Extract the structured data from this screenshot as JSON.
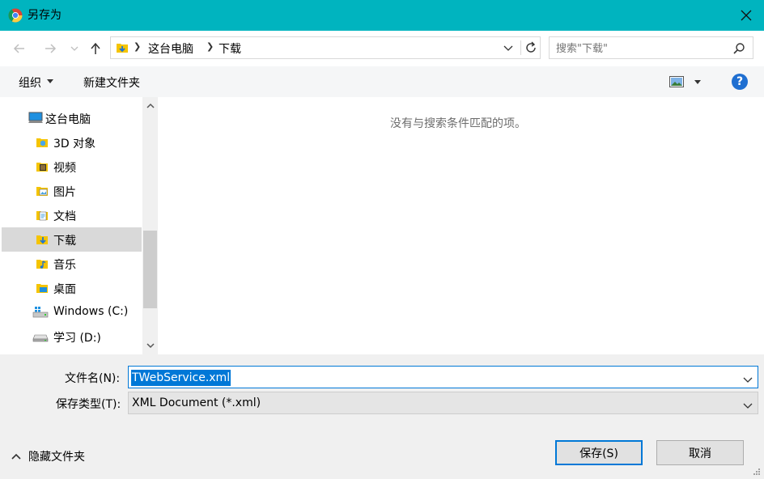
{
  "window": {
    "title": "另存为",
    "accent_color": "#00B4BF"
  },
  "nav": {
    "breadcrumb": [
      "这台电脑",
      "下载"
    ],
    "search_placeholder": "搜索\"下载\""
  },
  "toolbar": {
    "organize_label": "组织",
    "new_folder_label": "新建文件夹"
  },
  "sidebar": {
    "items": [
      {
        "label": "这台电脑",
        "icon": "computer-icon"
      },
      {
        "label": "3D 对象",
        "icon": "3d-objects-folder-icon"
      },
      {
        "label": "视频",
        "icon": "videos-folder-icon"
      },
      {
        "label": "图片",
        "icon": "pictures-folder-icon"
      },
      {
        "label": "文档",
        "icon": "documents-folder-icon"
      },
      {
        "label": "下载",
        "icon": "downloads-folder-icon",
        "selected": true
      },
      {
        "label": "音乐",
        "icon": "music-folder-icon"
      },
      {
        "label": "桌面",
        "icon": "desktop-folder-icon"
      },
      {
        "label": "Windows (C:)",
        "icon": "windows-drive-icon"
      },
      {
        "label": "学习 (D:)",
        "icon": "drive-icon"
      }
    ]
  },
  "content": {
    "empty_message": "没有与搜索条件匹配的项。"
  },
  "form": {
    "filename_label": "文件名(N):",
    "filename_value": "TWebService.xml",
    "filetype_label": "保存类型(T):",
    "filetype_value": "XML Document (*.xml)"
  },
  "footer": {
    "hide_folders_label": "隐藏文件夹",
    "save_label": "保存(S)",
    "cancel_label": "取消"
  }
}
